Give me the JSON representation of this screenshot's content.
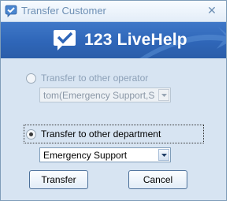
{
  "window": {
    "title": "Transfer Customer"
  },
  "banner": {
    "brand_text": "123 LiveHelp"
  },
  "options": {
    "operator": {
      "label": "Transfer to other operator",
      "selected": false,
      "value": "tom(Emergency Support,Sa"
    },
    "department": {
      "label": "Transfer to other department",
      "selected": true,
      "value": "Emergency Support"
    }
  },
  "buttons": {
    "transfer": "Transfer",
    "cancel": "Cancel"
  },
  "icons": {
    "title": "check-bubble-icon",
    "close": "close-icon",
    "dropdown": "chevron-down-icon"
  },
  "colors": {
    "banner": "#2f66b8",
    "dialog_bg": "#d7e4f2"
  }
}
